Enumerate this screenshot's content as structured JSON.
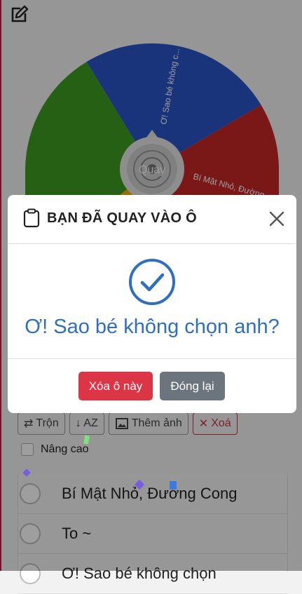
{
  "wheel": {
    "center_label": "Quay",
    "segments": [
      {
        "label": "Ơ! Sao bé không c...",
        "color": "#2a55c9"
      },
      {
        "label": "Bí Mật Nhỏ, Đường",
        "color": "#c62828"
      },
      {
        "label": "",
        "color": "#3c9c23"
      },
      {
        "label": "",
        "color": "#f4b400"
      }
    ]
  },
  "toolbar": {
    "shuffle_label": "Trộn",
    "sort_label": "↓ AZ",
    "add_image_label": "Thêm ảnh",
    "delete_label": "Xoá"
  },
  "advanced_label": "Nâng cao",
  "entries": [
    {
      "label": "Bí Mật Nhỏ, Đường Cong"
    },
    {
      "label": "To ~"
    },
    {
      "label": "Ơ! Sao bé không chọn"
    }
  ],
  "modal": {
    "title": "BẠN ĐÃ QUAY VÀO Ô",
    "result": "Ơ! Sao bé không chọn anh?",
    "delete_button": "Xóa ô này",
    "close_button": "Đóng lại"
  }
}
